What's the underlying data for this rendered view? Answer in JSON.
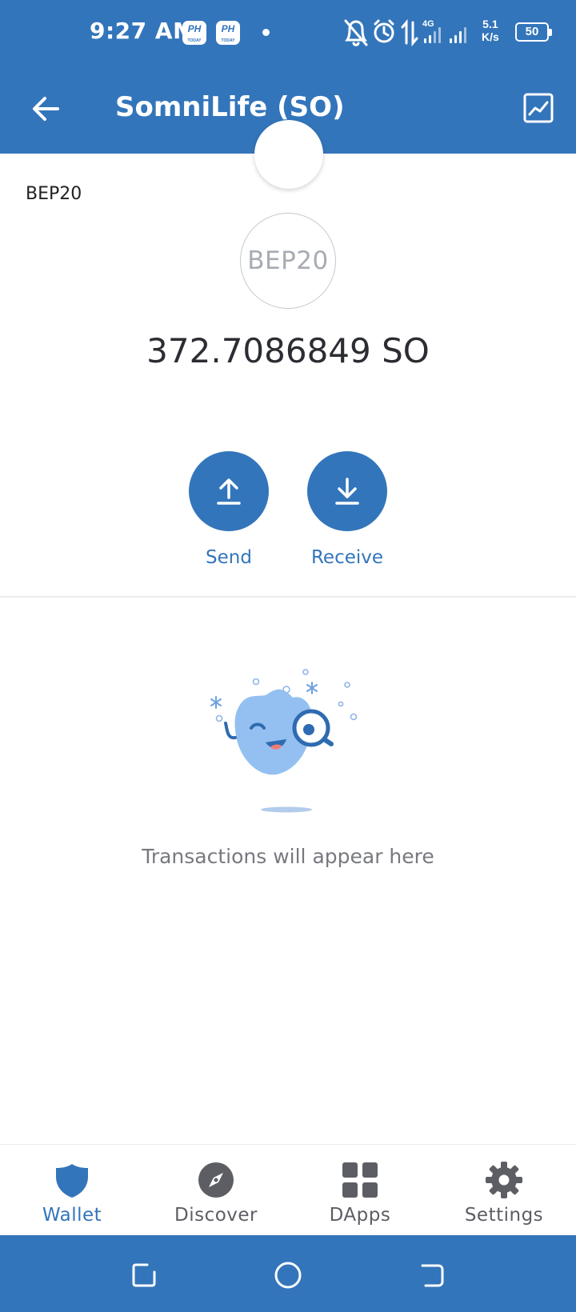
{
  "status_bar": {
    "time": "9:27 AM",
    "badges": [
      {
        "text": "PH",
        "sub": "TODAY"
      },
      {
        "text": "PH",
        "sub": "TODAY"
      }
    ],
    "network_type": "4G",
    "speed_value": "5.1",
    "speed_unit": "K/s",
    "battery": "50",
    "icons": [
      "notifications-off-icon",
      "alarm-icon",
      "data-transfer-icon",
      "signal-4g-icon",
      "signal-icon",
      "battery-icon"
    ]
  },
  "app_bar": {
    "title": "SomniLife (SO)",
    "back_icon": "arrow-left-icon",
    "chart_icon": "chart-line-icon"
  },
  "token": {
    "network_label": "BEP20",
    "logo_text": "BEP20",
    "balance": "372.7086849 SO"
  },
  "actions": [
    {
      "label": "Send",
      "icon": "upload-arrow-icon"
    },
    {
      "label": "Receive",
      "icon": "download-arrow-icon"
    }
  ],
  "empty_state": {
    "message": "Transactions will appear here",
    "illustration": "mascot-magnifier-illustration"
  },
  "bottom_nav": [
    {
      "label": "Wallet",
      "icon": "shield-icon",
      "active": true
    },
    {
      "label": "Discover",
      "icon": "compass-icon",
      "active": false
    },
    {
      "label": "DApps",
      "icon": "grid-icon",
      "active": false
    },
    {
      "label": "Settings",
      "icon": "gear-icon",
      "active": false
    }
  ],
  "colors": {
    "primary": "#3375bb",
    "inactive_nav": "#5c5e64",
    "balance_text": "#2b2d33",
    "muted_text": "#77797f",
    "mascot_body": "#93c0f0"
  }
}
